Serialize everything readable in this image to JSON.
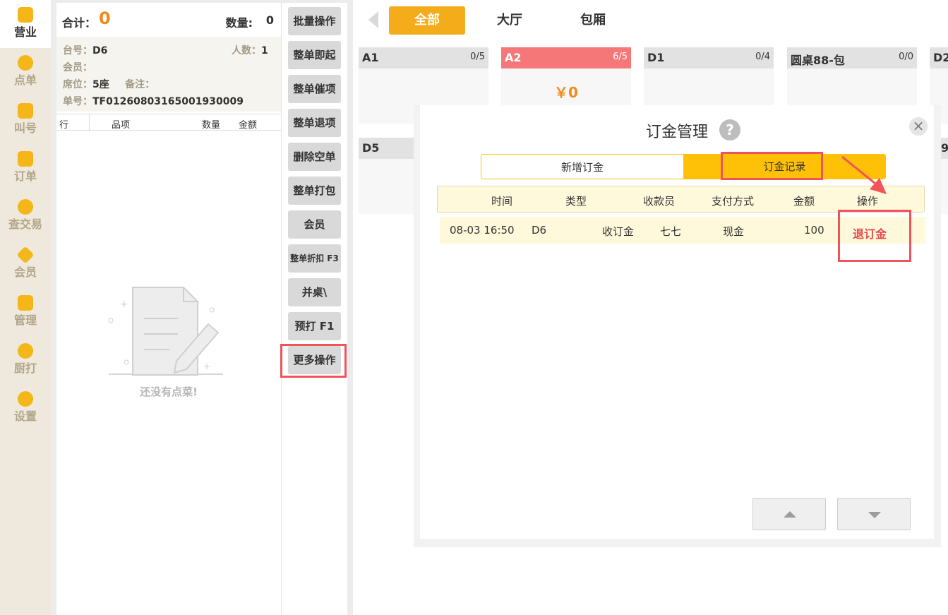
{
  "nav": {
    "items": [
      {
        "label": "营业",
        "icon": "chart-icon"
      },
      {
        "label": "点单",
        "icon": "hand-tap-icon"
      },
      {
        "label": "叫号",
        "icon": "number-ticket-icon"
      },
      {
        "label": "订单",
        "icon": "list-icon"
      },
      {
        "label": "查交易",
        "icon": "magnifier-icon"
      },
      {
        "label": "会员",
        "icon": "diamond-icon"
      },
      {
        "label": "管理",
        "icon": "checklist-icon"
      },
      {
        "label": "厨打",
        "icon": "printer-icon"
      },
      {
        "label": "设置",
        "icon": "gear-icon"
      }
    ]
  },
  "order": {
    "total_label": "合计：",
    "total_value": "0",
    "qty_label": "数量:",
    "qty_value": "0",
    "table_label": "台号：",
    "table_value": "D6",
    "people_label": "人数：",
    "people_value": "1",
    "member_label": "会员：",
    "seat_label": "席位：",
    "seat_value": "5座",
    "note_label": "备注：",
    "order_no_label": "单号：",
    "order_no_value": "TF0126080316500193000​9",
    "columns": [
      "行",
      "品项",
      "数量",
      "金额"
    ],
    "empty_text": "还没有点菜!"
  },
  "ops": {
    "buttons": [
      "批量操作",
      "整单即起",
      "整单催项",
      "整单退项",
      "删除空单",
      "整单打包",
      "会员",
      "整单折扣 F3",
      "并桌\\",
      "预打 F1",
      "更多操作"
    ]
  },
  "areas": {
    "tabs": [
      "全部",
      "大厅",
      "包厢"
    ]
  },
  "tables": [
    {
      "name": "A1",
      "cap": "0/5",
      "amount": ""
    },
    {
      "name": "A2",
      "cap": "6/5",
      "amount": "￥0"
    },
    {
      "name": "D1",
      "cap": "0/4",
      "amount": ""
    },
    {
      "name": "圆桌88-包",
      "cap": "0/0",
      "amount": ""
    },
    {
      "name": "D2",
      "cap": "",
      "amount": ""
    },
    {
      "name": "D5",
      "cap": "",
      "amount": ""
    },
    {
      "name": "9",
      "cap": "",
      "amount": ""
    }
  ],
  "modal": {
    "title": "订金管理",
    "help": "?",
    "close": "×",
    "tab_add": "新增订金",
    "tab_records": "订金记录",
    "columns": [
      "时间",
      "类型",
      "收款员",
      "支付方式",
      "金额",
      "操作"
    ],
    "rows": [
      {
        "time": "08-03 16:50",
        "table": "D6",
        "type": "收订金",
        "cashier": "七七",
        "method": "现金",
        "amount": "100",
        "action": "退订金"
      }
    ]
  },
  "colors": {
    "accent": "#f5ac1a",
    "busy": "#f57777",
    "highlight": "#f0545b",
    "amount": "#f08a1c"
  }
}
